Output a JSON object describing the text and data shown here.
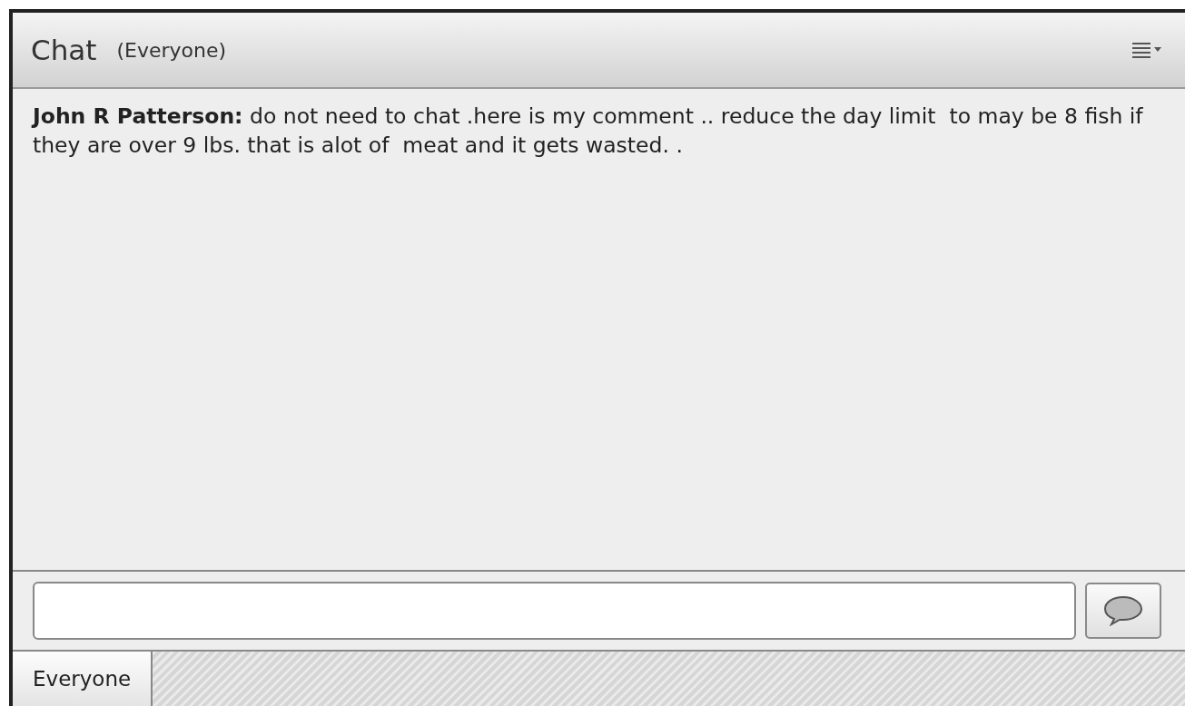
{
  "panel": {
    "title": "Chat",
    "audience": "(Everyone)"
  },
  "messages": [
    {
      "text": "**John R Patterson:** do not need to chat .here is my comment .. reduce the day limit  to may be 8 fish if they are over 9 lbs. that is alot of  meat and it gets wasted. ."
    }
  ],
  "tabs": [
    {
      "label": "Everyone",
      "selected": true
    }
  ]
}
